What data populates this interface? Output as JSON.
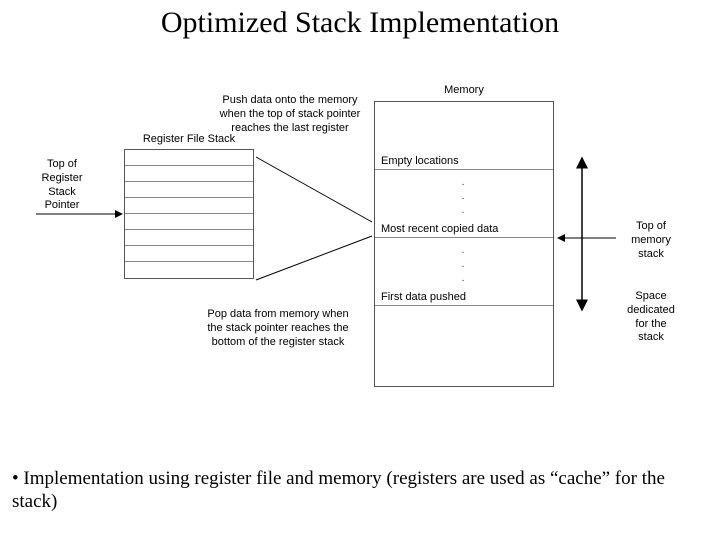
{
  "title": "Optimized Stack Implementation",
  "labels": {
    "memory": "Memory",
    "register_file_stack": "Register File Stack",
    "top_pointer": "Top of\nRegister\nStack\nPointer",
    "push_note": "Push data onto the memory\nwhen the top of stack pointer\nreaches the last register",
    "pop_note": "Pop data from memory when\nthe stack pointer reaches the\nbottom of the register stack",
    "empty": "Empty locations",
    "most_recent": "Most recent copied data",
    "first": "First data pushed",
    "top_mem": "Top of\nmemory\nstack",
    "space": "Space\ndedicated\nfor the\nstack"
  },
  "bullet": "Implementation using register file and memory (registers are used as “cache” for the stack)"
}
